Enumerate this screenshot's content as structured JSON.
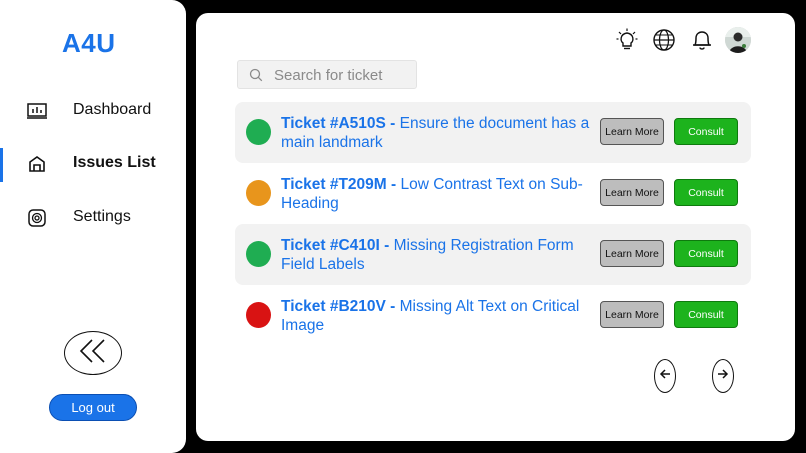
{
  "brand": {
    "name": "A4U",
    "color": "#1a73e8"
  },
  "sidebar": {
    "items": [
      {
        "label": "Dashboard",
        "icon": "dashboard-icon",
        "active": false
      },
      {
        "label": "Issues List",
        "icon": "issues-icon",
        "active": true
      },
      {
        "label": "Settings",
        "icon": "settings-icon",
        "active": false
      }
    ],
    "collapse_icon": "double-chevron-left-icon",
    "logout_label": "Log out"
  },
  "topbar": {
    "icons": [
      "lightbulb-icon",
      "globe-icon",
      "bell-icon",
      "avatar"
    ]
  },
  "search": {
    "placeholder": "Search for ticket",
    "value": ""
  },
  "tickets": [
    {
      "id": "Ticket #A510S -",
      "title": "Ensure the document has a main landmark",
      "status_color": "#1fad52",
      "shaded": true,
      "learn_label": "Learn More",
      "consult_label": "Consult"
    },
    {
      "id": "Ticket #T209M -",
      "title": "Low Contrast Text on Sub-Heading",
      "status_color": "#e8951c",
      "shaded": false,
      "learn_label": "Learn More",
      "consult_label": "Consult"
    },
    {
      "id": "Ticket #C410I -",
      "title": "Missing Registration Form Field Labels",
      "status_color": "#1fad52",
      "shaded": true,
      "learn_label": "Learn More",
      "consult_label": "Consult"
    },
    {
      "id": "Ticket #B210V -",
      "title": "Missing Alt Text on Critical Image",
      "status_color": "#d91313",
      "shaded": false,
      "learn_label": "Learn More",
      "consult_label": "Consult"
    }
  ],
  "pagination": {
    "prev_icon": "arrow-left-icon",
    "next_icon": "arrow-right-icon"
  },
  "colors": {
    "accent": "#1a73e8",
    "consult": "#1db31d",
    "learn": "#bdbdbd"
  }
}
